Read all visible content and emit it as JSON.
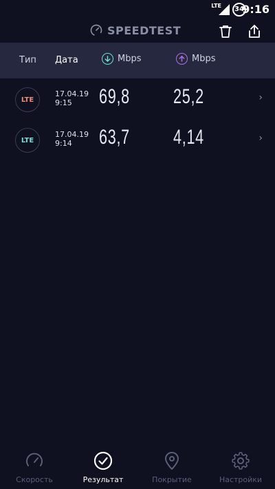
{
  "statusbar": {
    "network": "LTE",
    "battery": "34",
    "time": "9:16"
  },
  "app": {
    "title": "SPEEDTEST"
  },
  "header": {
    "type_label": "Тип",
    "date_label": "Дата",
    "download_unit": "Mbps",
    "upload_unit": "Mbps"
  },
  "results": [
    {
      "type": "LTE",
      "date": "17.04.19",
      "time": "9:15",
      "download": "69,8",
      "upload": "25,2",
      "badge_color": "#f08a6e"
    },
    {
      "type": "LTE",
      "date": "17.04.19",
      "time": "9:14",
      "download": "63,7",
      "upload": "4,14",
      "badge_color": "#6fe0d2"
    }
  ],
  "nav": [
    {
      "label": "Скорость",
      "icon": "speedometer-icon",
      "active": false
    },
    {
      "label": "Результат",
      "icon": "check-circle-icon",
      "active": true
    },
    {
      "label": "Покрытие",
      "icon": "map-pin-icon",
      "active": false
    },
    {
      "label": "Настройки",
      "icon": "gear-icon",
      "active": false
    }
  ],
  "colors": {
    "background": "#0f1020",
    "header": "#25283e",
    "download": "#6fe0d2",
    "upload": "#b36ee0"
  }
}
